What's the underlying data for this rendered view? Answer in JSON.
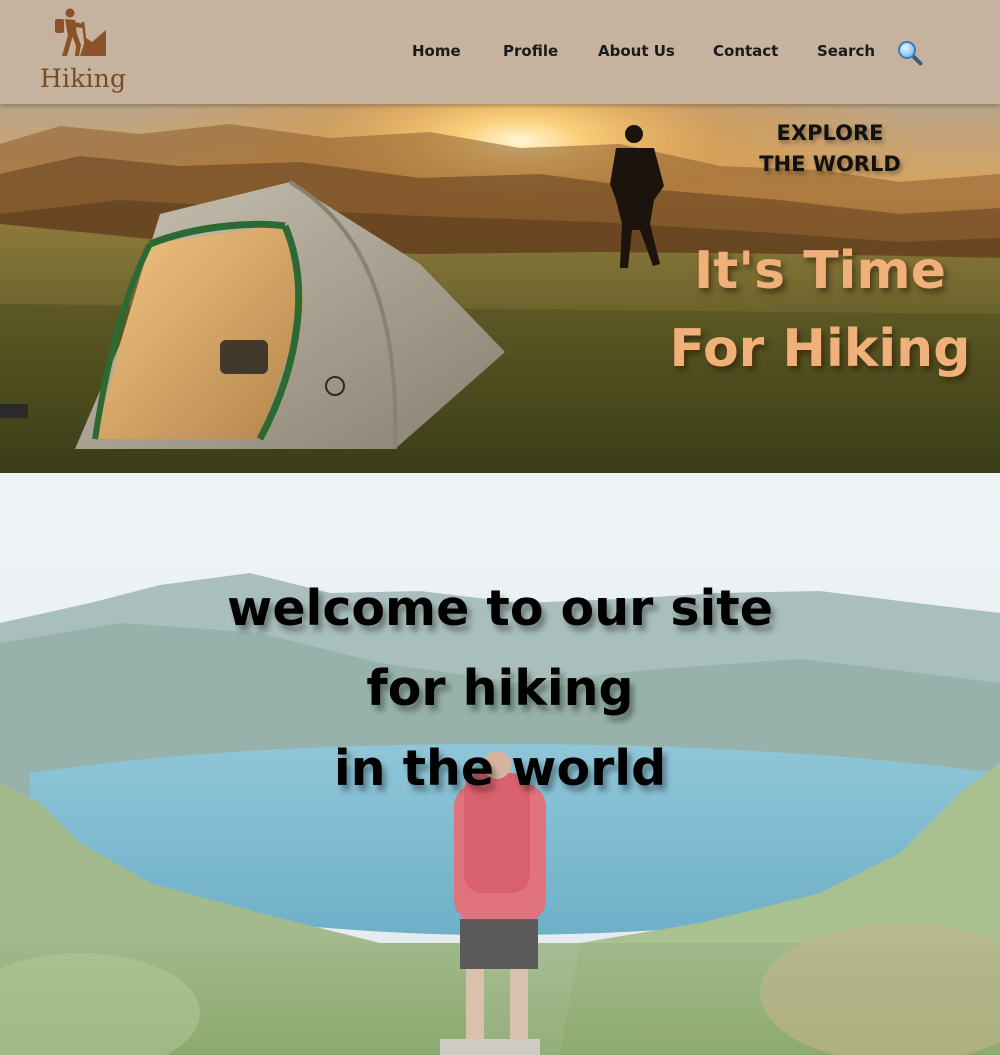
{
  "brand": {
    "name": "Hiking",
    "logo_icon": "hiker-icon",
    "color": "#7a4a22"
  },
  "nav": {
    "items": [
      {
        "label": "Home"
      },
      {
        "label": "Profile"
      },
      {
        "label": "About Us"
      },
      {
        "label": "Contact"
      },
      {
        "label": "Search"
      }
    ],
    "search_icon": "magnifier-icon"
  },
  "hero": {
    "tagline_line1": "EXPLORE",
    "tagline_line2": "THE WORLD",
    "title_line1": "It's Time",
    "title_line2": "For Hiking",
    "title_color": "#f0b07a"
  },
  "welcome": {
    "line1": "welcome to our site",
    "line2": "for hiking",
    "line3": "in the world"
  },
  "colors": {
    "header_bg": "#c6b39f"
  }
}
